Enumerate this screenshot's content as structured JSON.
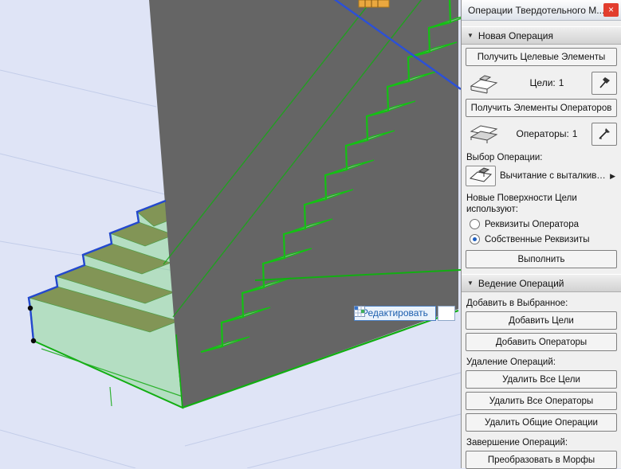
{
  "viewport": {
    "edit_tooltip": "Редактировать"
  },
  "icons": {
    "close": "×",
    "collapse": "▼",
    "dropdown_arrow": "▶"
  },
  "panel": {
    "title": "Операции Твердотельного М...",
    "new_operation": {
      "header": "Новая Операция",
      "get_targets_button": "Получить Целевые Элементы",
      "targets_label": "Цели:",
      "targets_count": "1",
      "get_operators_button": "Получить Элементы Операторов",
      "operators_label": "Операторы:",
      "operators_count": "1",
      "choose_operation_label": "Выбор Операции:",
      "operation_value": "Вычитание с выталкивание...",
      "surfaces_label_line1": "Новые Поверхности Цели",
      "surfaces_label_line2": "используют:",
      "radio_operator_attributes": "Реквизиты Оператора",
      "radio_own_attributes": "Собственные Реквизиты",
      "execute_button": "Выполнить"
    },
    "manage_operations": {
      "header": "Ведение Операций",
      "add_to_selection_label": "Добавить в Выбранное:",
      "add_targets_button": "Добавить Цели",
      "add_operators_button": "Добавить Операторы",
      "delete_operations_label": "Удаление Операций:",
      "delete_all_targets_button": "Удалить Все Цели",
      "delete_all_operators_button": "Удалить Все Операторы",
      "delete_common_operations_button": "Удалить Общие Операции",
      "finish_operations_label": "Завершение Операций:",
      "convert_to_morphs_button": "Преобразовать в Морфы"
    }
  },
  "colors": {
    "selection_green": "#14c114",
    "edit_blue": "#2b50d8",
    "close_red": "#e23d2e"
  }
}
